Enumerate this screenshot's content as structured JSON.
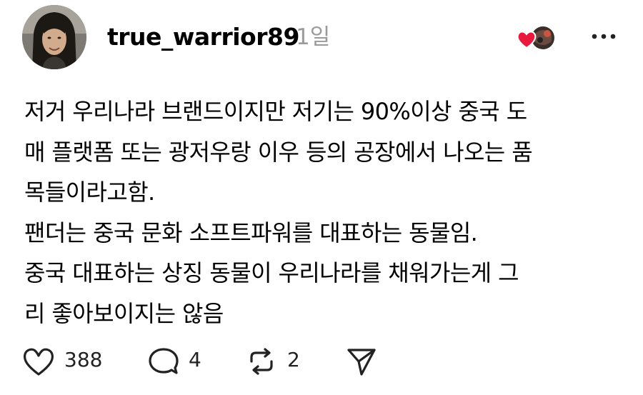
{
  "post": {
    "author": {
      "username": "true_warrior89",
      "timestamp": "1일",
      "avatar_icon": "profile-photo"
    },
    "liked_by_icons": [
      "heart-icon",
      "liker-avatar"
    ],
    "menu_icon": "more-horizontal-icon",
    "body_lines": [
      "저거 우리나라 브랜드이지만 저기는 90%이상 중국 도",
      "매 플랫폼 또는 광저우랑 이우 등의 공장에서 나오는 품",
      "목들이라고함.",
      "팬더는 중국 문화 소프트파워를 대표하는 동물임.",
      "중국 대표하는 상징 동물이 우리나라를 채워가는게 그",
      "리 좋아보이지는 않음"
    ],
    "actions": {
      "like": {
        "icon": "heart-outline-icon",
        "count": "388"
      },
      "reply": {
        "icon": "comment-bubble-icon",
        "count": "4"
      },
      "repost": {
        "icon": "repost-icon",
        "count": "2"
      },
      "share": {
        "icon": "send-icon"
      }
    }
  },
  "colors": {
    "text": "#000000",
    "muted": "#9b9b9b",
    "heart_red": "#e8193c"
  }
}
